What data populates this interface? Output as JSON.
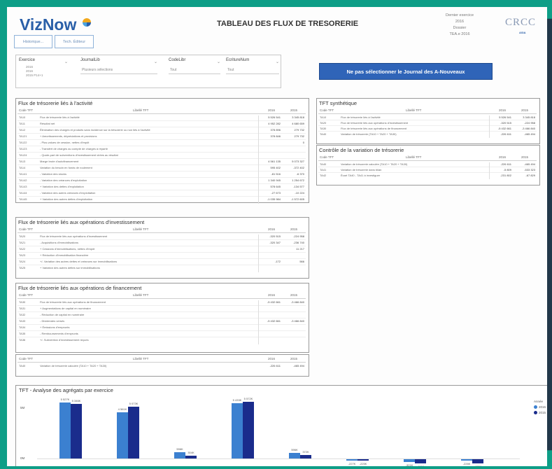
{
  "app": {
    "logo_viz": "VizNow",
    "title": "TABLEAU DES FLUX DE TRESORERIE"
  },
  "meta": {
    "lines": [
      "Dernier exercice",
      "2016",
      "Dossier",
      "TEA.e 2016"
    ]
  },
  "brand": {
    "crcc": "CRCC",
    "crcc_sub": "ASIA"
  },
  "buttons": {
    "btn1": "Historique...",
    "btn2": "Tech. Éditeur"
  },
  "filters": {
    "exercice": {
      "label": "Exercice",
      "values": [
        "2016",
        "2016",
        "2015 P14+1"
      ]
    },
    "journal": {
      "label": "JournalLib",
      "value": "Plusieurs sélections"
    },
    "codelibr": {
      "label": "CodeLibr",
      "value": "Tout"
    },
    "ecriture": {
      "label": "EcritureNum",
      "value": "Tout"
    }
  },
  "banner": "Ne pas sélectionner le Journal des A-Nouveaux",
  "colors": {
    "accent": "#2f64b8",
    "teal": "#0e9e87",
    "navy": "#22384a",
    "bar2016": "#3b80d0",
    "bar2015": "#1a2c8c"
  },
  "sections": {
    "activite": {
      "title": "Flux de trésorerie liés à l'activité",
      "headers": [
        "Code TFT",
        "Libellé TFT",
        "2016",
        "2015"
      ],
      "rows": [
        [
          "TA10",
          "Flux de trésorerie liés à l'activité",
          "5 526 541",
          "3 345 818"
        ],
        [
          "TA11",
          "Résultat net",
          "4 952 282",
          "4 680 659"
        ],
        [
          "TA12",
          "Élimination des charges et produits sans incidence sur la trésorerie ou non liés à l'activité",
          "378 896",
          "279 732"
        ],
        [
          "TA121",
          "+ Amortissements, dépréciations et provisions",
          "378 846",
          "279 732"
        ],
        [
          "TA122",
          "- Plus-values de cession, nettes d'impôt",
          "",
          "0"
        ],
        [
          "TA123",
          "- Transfert de charges au compte de charges à répartir",
          "",
          ""
        ],
        [
          "TA124",
          "- Quote-part de subventions d'investissement virées au résultat",
          "",
          ""
        ],
        [
          "TA13",
          "Marge brute d'autofinancement",
          "4 561 135",
          "5 073 327"
        ],
        [
          "TA14",
          "Variation du besoin en fonds de roulement",
          "595 402",
          "-372 402"
        ],
        [
          "TA141",
          "- Variation des stocks",
          "-81 516",
          "-6 370"
        ],
        [
          "TA142",
          "- Variation des créances d'exploitation",
          "1 340 945",
          "1 254 672"
        ],
        [
          "TA143",
          "+ Variation des dettes d'exploitation",
          "578 645",
          "-134 577"
        ],
        [
          "TA144",
          "- Variation des autres créances d'exploitation",
          "-27 673",
          "-10 224"
        ],
        [
          "TA145",
          "+ Variation des autres dettes d'exploitation",
          "-1 035 984",
          "-1 572 605"
        ]
      ]
    },
    "investissement": {
      "title": "Flux de trésorerie liés aux opérations d'investissement",
      "headers": [
        "Code TFT",
        "Libellé TFT",
        "2016",
        "2015"
      ],
      "rows": [
        [
          "TA20",
          "Flux de trésorerie liés aux opérations d'investissement",
          "-320 515",
          "-224 958"
        ],
        [
          "TA21",
          "- Acquisitions d'immobilisations",
          "-320 347",
          "-236 740"
        ],
        [
          "TA22",
          "+ Cessions d'immobilisations, nettes d'impôt",
          "",
          "11 217"
        ],
        [
          "TA23",
          "+ Réduction d'immobilisation financière",
          "",
          ""
        ],
        [
          "TA24",
          "+/- Variation des autres dettes et créances sur immobilisations",
          "-172",
          "566"
        ],
        [
          "TA25",
          "+ Variation des autres dettes sur immobilisations",
          "",
          ""
        ]
      ]
    },
    "financement": {
      "title": "Flux de trésorerie liés aux opérations de financement",
      "headers": [
        "Code TFT",
        "Libellé TFT",
        "2016",
        "2015"
      ],
      "rows": [
        [
          "TA30",
          "Flux de trésorerie liés aux opérations de financement",
          "-5 432 661",
          "-3 466 840"
        ],
        [
          "TA31",
          "+ Augmentations de capital en numéraire",
          "",
          ""
        ],
        [
          "TA32",
          "- Réduction de capital en numéraire",
          "",
          ""
        ],
        [
          "TA33",
          "- Dividendes versés",
          "-5 432 661",
          "-3 466 840"
        ],
        [
          "TA34",
          "+ Émissions d'emprunts",
          "",
          ""
        ],
        [
          "TA35",
          "- Remboursements d'emprunts",
          "",
          ""
        ],
        [
          "TA36",
          "+/- Subvention d'investissement reçues",
          "",
          ""
        ]
      ]
    },
    "variation": {
      "headers": [
        "Code TFT",
        "Libellé TFT",
        "2016",
        "2015"
      ],
      "rows": [
        [
          "TA40",
          "Variation de trésorerie calculée (TA10 + TA20 + TA30)",
          "-226 611",
          "-465 494"
        ]
      ]
    },
    "synthetique": {
      "title": "TFT synthétique",
      "headers": [
        "Code TFT",
        "Libellé TFT",
        "2016",
        "2015"
      ],
      "rows": [
        [
          "TA10",
          "Flux de trésorerie liés à l'activité",
          "5 526 541",
          "3 345 818"
        ],
        [
          "TA20",
          "Flux de trésorerie liés aux opérations d'investissement",
          "-320 515",
          "-224 958"
        ],
        [
          "TA30",
          "Flux de trésorerie liés aux opérations de financement",
          "-5 432 661",
          "-3 466 840"
        ],
        [
          "TA40",
          "Variation de trésorerie (TA10 + TA20 + TA30)",
          "-226 611",
          "-465 494"
        ]
      ]
    },
    "controle": {
      "title": "Contrôle de la variation de trésorerie",
      "headers": [
        "Code TFT",
        "Libellé TFT",
        "2016",
        "2015"
      ],
      "rows": [
        [
          "TA40",
          "Variation de trésorerie calculée (TA10 + TA20 + TA30)",
          "-226 611",
          "-465 494"
        ],
        [
          "TA41",
          "Variation de trésorerie dans bilan",
          "-5 809",
          "-533 323"
        ],
        [
          "TA42",
          "Écart TA40 - TA41 à investiguer",
          "-231 802",
          "-67 829"
        ]
      ]
    }
  },
  "chart_data": {
    "type": "bar",
    "title": "TFT - Analyse des agrégats par exercice",
    "legend": {
      "title": "Année",
      "entries": [
        "2016",
        "2015"
      ],
      "placement": "right"
    },
    "yticks": [
      "5M",
      "0M"
    ],
    "ylim": [
      -0.7,
      6.0
    ],
    "series": [
      {
        "name": "2016",
        "values": [
          5.53,
          4.56,
          0.6,
          5.43,
          0.58,
          -0.23,
          -0.32,
          -0.23
        ]
      },
      {
        "name": "2015",
        "values": [
          5.35,
          5.07,
          0.31,
          5.57,
          0.37,
          -0.23,
          -0.47,
          -0.47
        ]
      }
    ],
    "value_labels": [
      [
        "5 527K",
        "4 561K",
        "596K",
        "5 433K",
        "596K",
        "-227K",
        "-321K",
        "-226K"
      ],
      [
        "5 346K",
        "5 073K",
        "304K",
        "5 572K",
        "372K",
        "-225K",
        "-465K",
        "-465K"
      ]
    ]
  }
}
